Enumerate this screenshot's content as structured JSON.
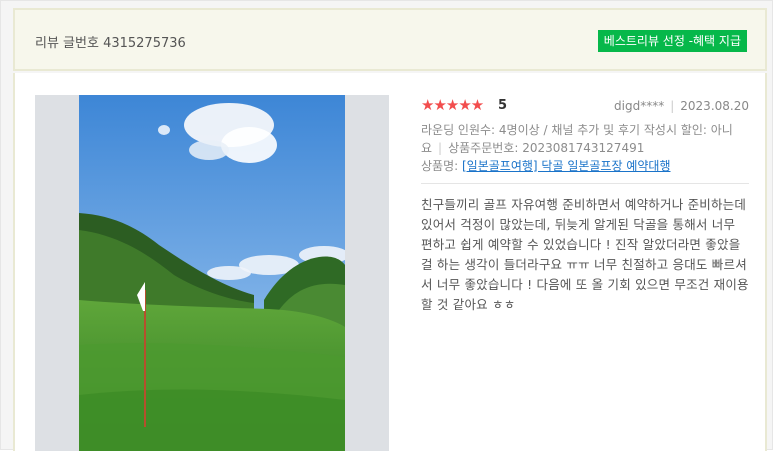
{
  "header": {
    "review_number": "리뷰 글번호 4315275736",
    "best_badge": "베스트리뷰 선정 -혜택 지급"
  },
  "review": {
    "stars": "★★★★★",
    "rating": "5",
    "user": "digd****",
    "date": "2023.08.20",
    "options": "라운딩 인원수: 4명이상 / 채널 추가 및 후기 작성시 할인: 아니요",
    "order_number": "상품주문번호: 2023081743127491",
    "product_label": "상품명:",
    "product_name": "[일본골프여행] 닥골 일본골프장 예약대행",
    "content": "친구들끼리 골프 자유여행 준비하면서 예약하거나 준비하는데 있어서 걱정이 많았는데, 뒤늦게 알게된 닥골을 통해서 너무 편하고 쉽게 예약할 수 있었습니다 ! 진작 알았더라면 좋았을걸 하는 생각이 들더라구요 ㅠㅠ 너무 친절하고 응대도 빠르셔서 너무 좋았습니다 ! 다음에 또 올 기회 있으면 무조건 재이용할 것 같아요 ㅎㅎ"
  },
  "colors": {
    "badge_bg": "#06b84a",
    "star": "#f24d4d",
    "link": "#1a73c9",
    "header_bg": "#f7f7ec"
  },
  "icons": {
    "star": "star-icon"
  }
}
